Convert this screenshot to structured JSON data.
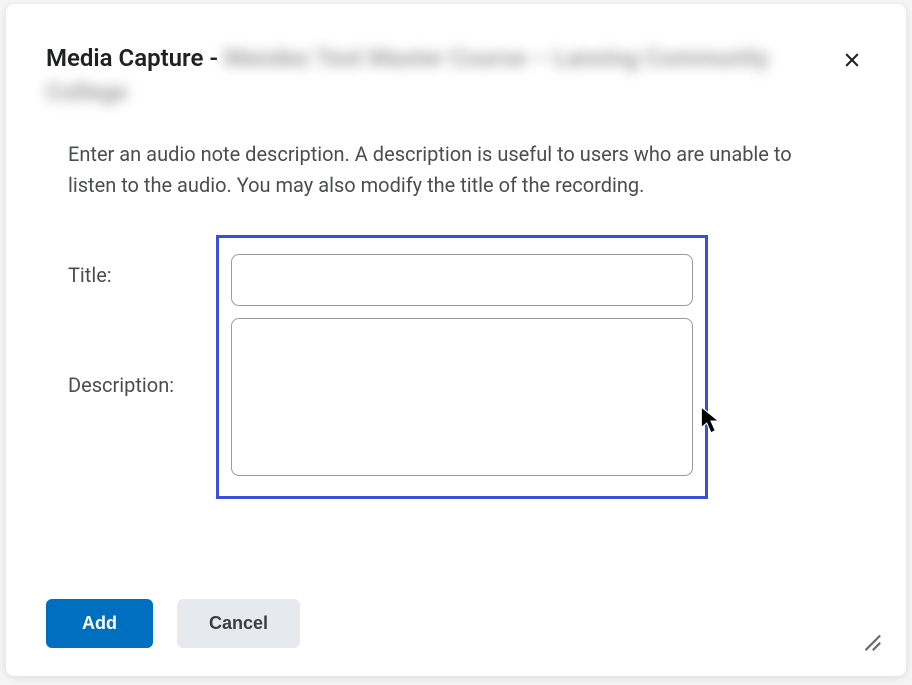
{
  "dialog": {
    "title_prefix": "Media Capture - ",
    "title_blurred": "Mendez Test Master Course – Lansing Community College",
    "instructions": "Enter an audio note description. A description is useful to users who are unable to listen to the audio. You may also modify the title of the recording."
  },
  "form": {
    "title_label": "Title:",
    "description_label": "Description:",
    "title_value": "",
    "description_value": ""
  },
  "buttons": {
    "add": "Add",
    "cancel": "Cancel"
  }
}
